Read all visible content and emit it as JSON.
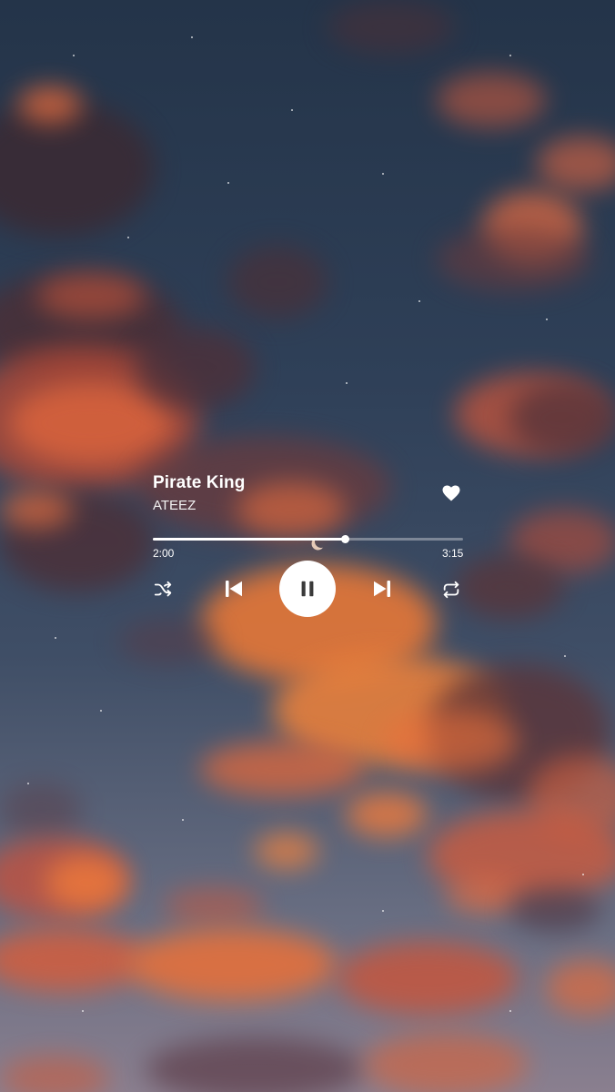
{
  "track": {
    "title": "Pirate King",
    "artist": "ATEEZ",
    "elapsed": "2:00",
    "duration": "3:15",
    "progress": 0.62
  },
  "controls": {
    "shuffle_icon": "shuffle-icon",
    "previous_icon": "skip-previous-icon",
    "play_state": "playing",
    "pause_icon": "pause-icon",
    "next_icon": "skip-next-icon",
    "repeat_icon": "repeat-icon",
    "like_icon": "heart-icon",
    "liked": true
  },
  "colors": {
    "foreground": "#ffffff",
    "play_button_icon": "#3a3a3a"
  }
}
